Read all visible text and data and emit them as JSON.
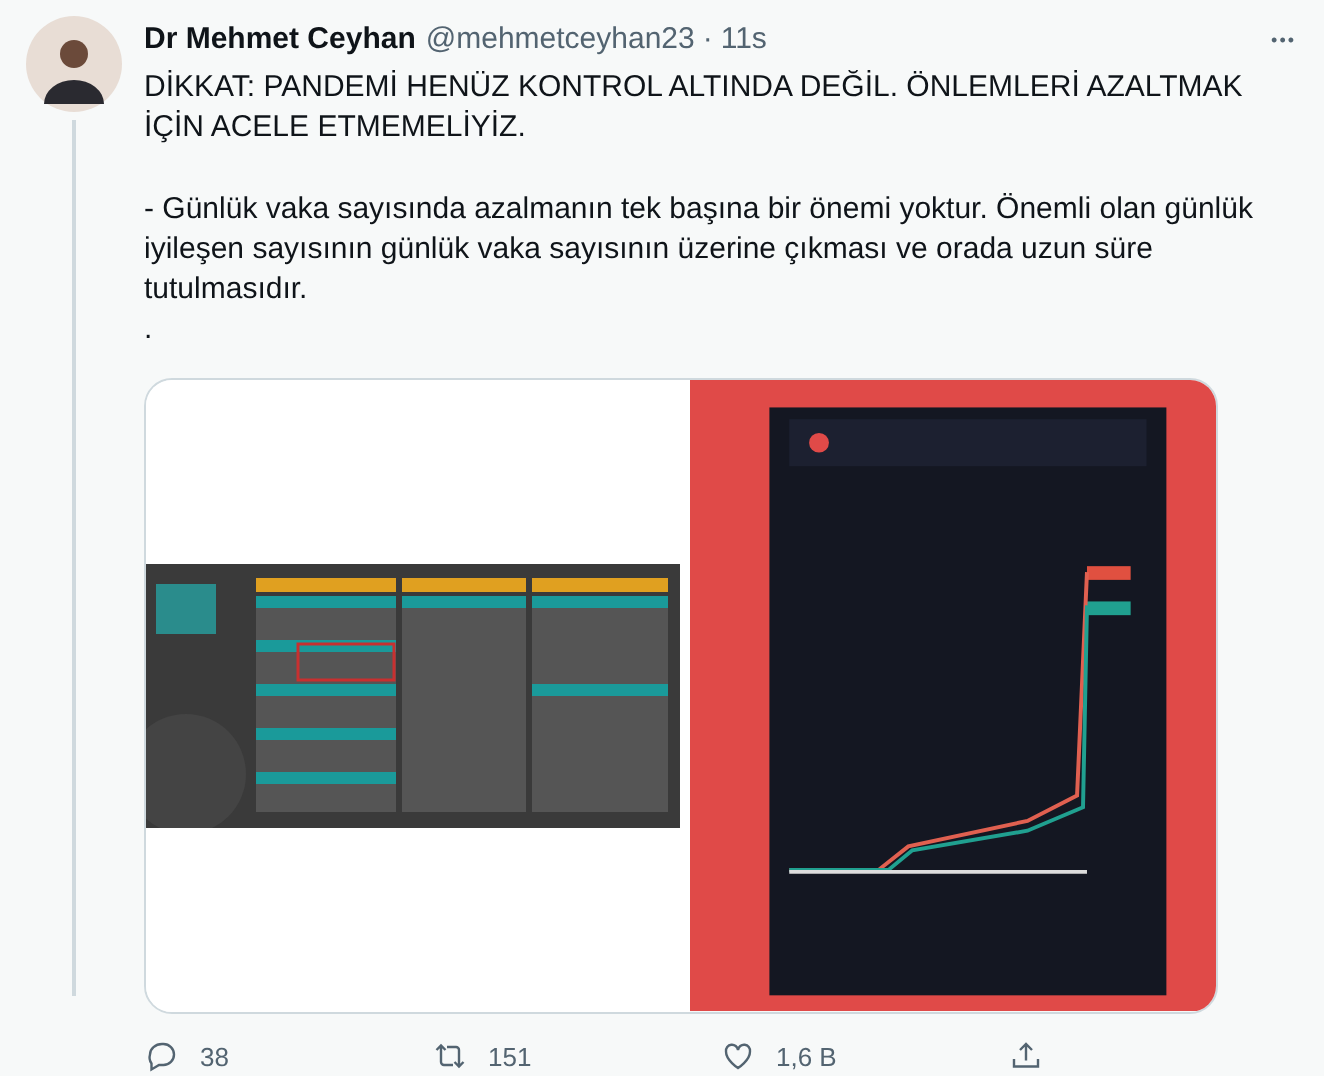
{
  "tweet": {
    "name": "Dr Mehmet Ceyhan",
    "handle": "@mehmetceyhan23",
    "separator": "·",
    "time": "11s",
    "more": "•••",
    "paragraphs": [
      "DİKKAT: PANDEMİ HENÜZ KONTROL ALTINDA DEĞİL. ÖNLEMLERİ AZALTMAK İÇİN ACELE ETMEMELİYİZ.",
      "- Günlük vaka sayısında azalmanın tek başına bir önemi yoktur. Önemli olan günlük iyileşen sayısının günlük vaka sayısının üzerine çıkması ve orada uzun süre tutulmasıdır.",
      "."
    ],
    "media": [
      {
        "kind": "picture"
      },
      {
        "kind": "picture"
      }
    ],
    "actions": [
      {
        "kind": "reply",
        "count": "38"
      },
      {
        "kind": "retweet",
        "count": "151"
      },
      {
        "kind": "like",
        "count": "1,6 B"
      },
      {
        "kind": "share"
      }
    ]
  }
}
